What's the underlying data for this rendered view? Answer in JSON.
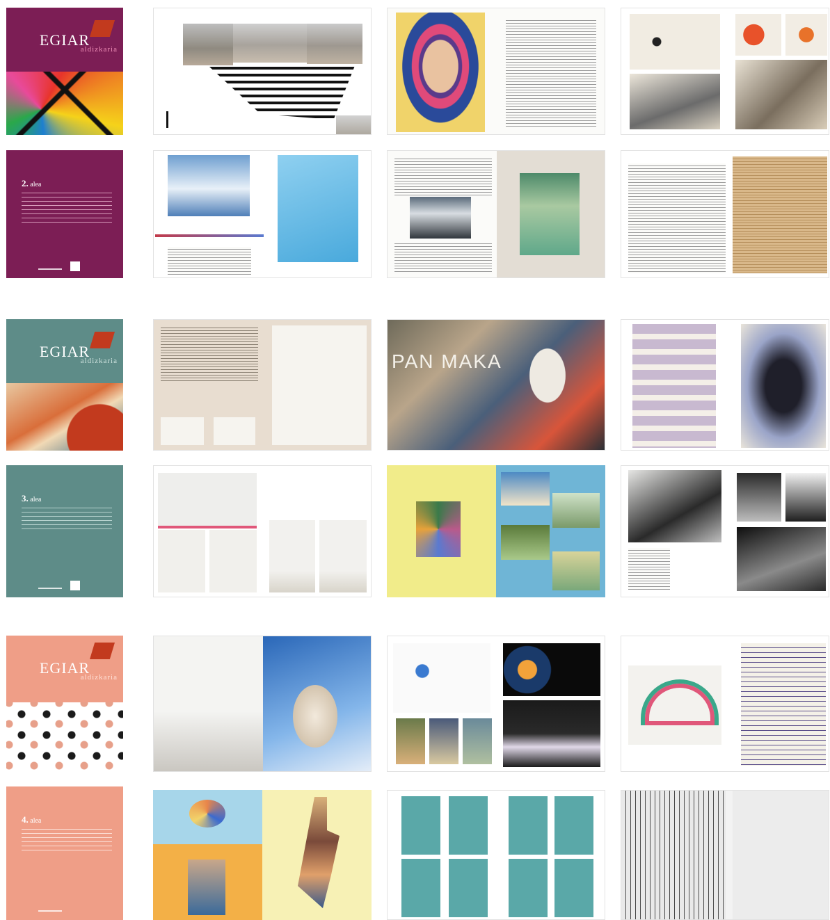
{
  "colors": {
    "purple": "#7c1e55",
    "teal": "#5e8c88",
    "salmon": "#ef9e87",
    "flag": "#c23a1e"
  },
  "issues": [
    {
      "cover": {
        "title": "EGIAR",
        "subtitle": "aldizkaria",
        "color": "#7c1e55",
        "sub_color": "#f08fb8"
      },
      "back": {
        "issue_number": "2.",
        "issue_word": "alea"
      }
    },
    {
      "cover": {
        "title": "EGIAR",
        "subtitle": "aldizkaria",
        "color": "#5e8c88",
        "sub_color": "#cfe3df"
      },
      "back": {
        "issue_number": "3.",
        "issue_word": "alea"
      }
    },
    {
      "cover": {
        "title": "EGIAR",
        "subtitle": "aldizkaria",
        "color": "#ef9e87",
        "sub_color": "#ffe3da"
      },
      "back": {
        "issue_number": "4.",
        "issue_word": "alea"
      }
    }
  ],
  "spread_labels": {
    "pan_maka": "PAN MAKA"
  }
}
